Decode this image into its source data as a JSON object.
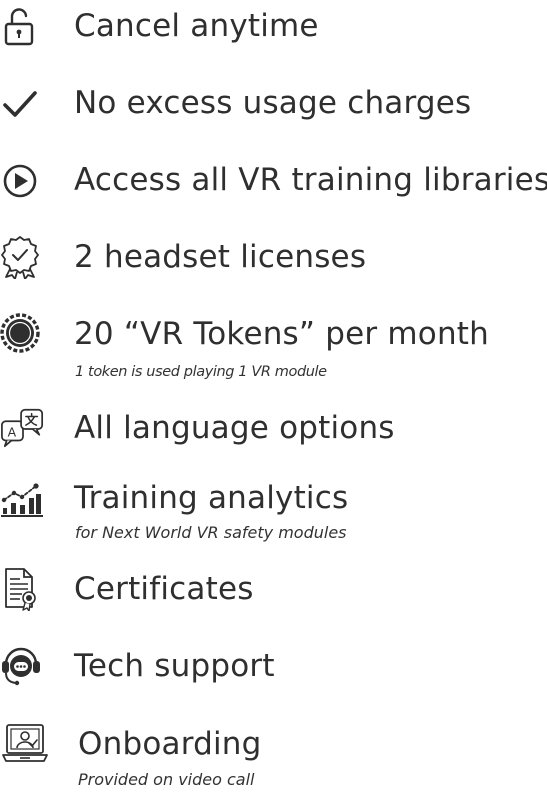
{
  "accent_color": "#2f2f2f",
  "features": [
    {
      "id": "cancel",
      "icon": "padlock-unlocked-icon",
      "label": "Cancel anytime"
    },
    {
      "id": "no-charges",
      "icon": "checkmark-icon",
      "label": "No excess usage charges"
    },
    {
      "id": "libraries",
      "icon": "play-circle-icon",
      "label": "Access all VR training libraries"
    },
    {
      "id": "licenses",
      "icon": "award-badge-icon",
      "label": "2 headset licenses"
    },
    {
      "id": "tokens",
      "icon": "token-coin-icon",
      "label": "20 “VR Tokens” per month",
      "sub": "1 token is used playing 1 VR module"
    },
    {
      "id": "languages",
      "icon": "translate-bubbles-icon",
      "label": "All language options"
    },
    {
      "id": "analytics",
      "icon": "analytics-chart-icon",
      "label": "Training analytics",
      "sub": "for Next World VR safety modules"
    },
    {
      "id": "certificates",
      "icon": "certificate-document-icon",
      "label": "Certificates"
    },
    {
      "id": "support",
      "icon": "headset-support-icon",
      "label": "Tech support"
    },
    {
      "id": "onboarding",
      "icon": "laptop-video-call-icon",
      "label": "Onboarding",
      "sub": "Provided on video call"
    }
  ]
}
